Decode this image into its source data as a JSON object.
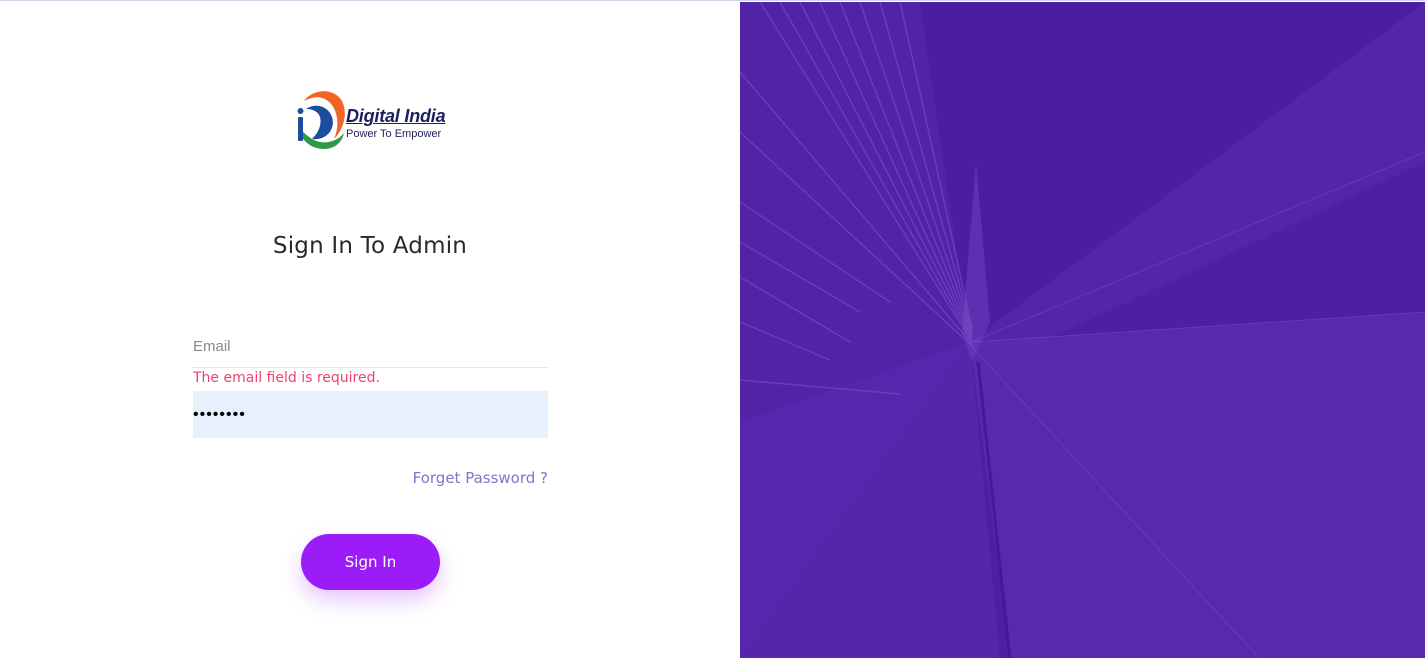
{
  "logo": {
    "title": "Digital India",
    "tagline": "Power To Empower",
    "icon": "digital-india-logo"
  },
  "form": {
    "heading": "Sign In To Admin",
    "email_placeholder": "Email",
    "email_value": "",
    "email_error": "The email field is required.",
    "password_value": "••••••••",
    "forgot_label": "Forget Password ?",
    "submit_label": "Sign In"
  },
  "colors": {
    "accent": "#9c1cf7",
    "error": "#f1416c",
    "link": "#7f75c9",
    "hero_background": "#4e1fa2",
    "autofill_background": "#e8f0fe"
  }
}
